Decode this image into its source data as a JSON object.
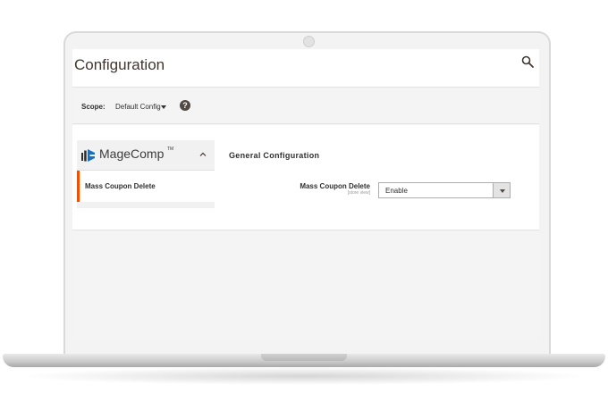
{
  "header": {
    "title": "Configuration",
    "search_icon": "search-icon"
  },
  "scope": {
    "label": "Scope:",
    "value": "Default Config",
    "help_icon": "?"
  },
  "sidebar": {
    "brand": {
      "name": "MageComp",
      "tm": "TM",
      "logo_icon": "magecomp-logo-icon",
      "collapse_icon": "chevron-up-icon"
    },
    "items": [
      {
        "label": "Mass Coupon Delete",
        "active": true
      }
    ]
  },
  "main": {
    "section_title": "General Configuration",
    "fields": [
      {
        "label": "Mass Coupon Delete",
        "scope": "[store view]",
        "value": "Enable"
      }
    ]
  },
  "colors": {
    "accent": "#eb5202",
    "brand_blue": "#1f6fb7",
    "text": "#303030"
  }
}
